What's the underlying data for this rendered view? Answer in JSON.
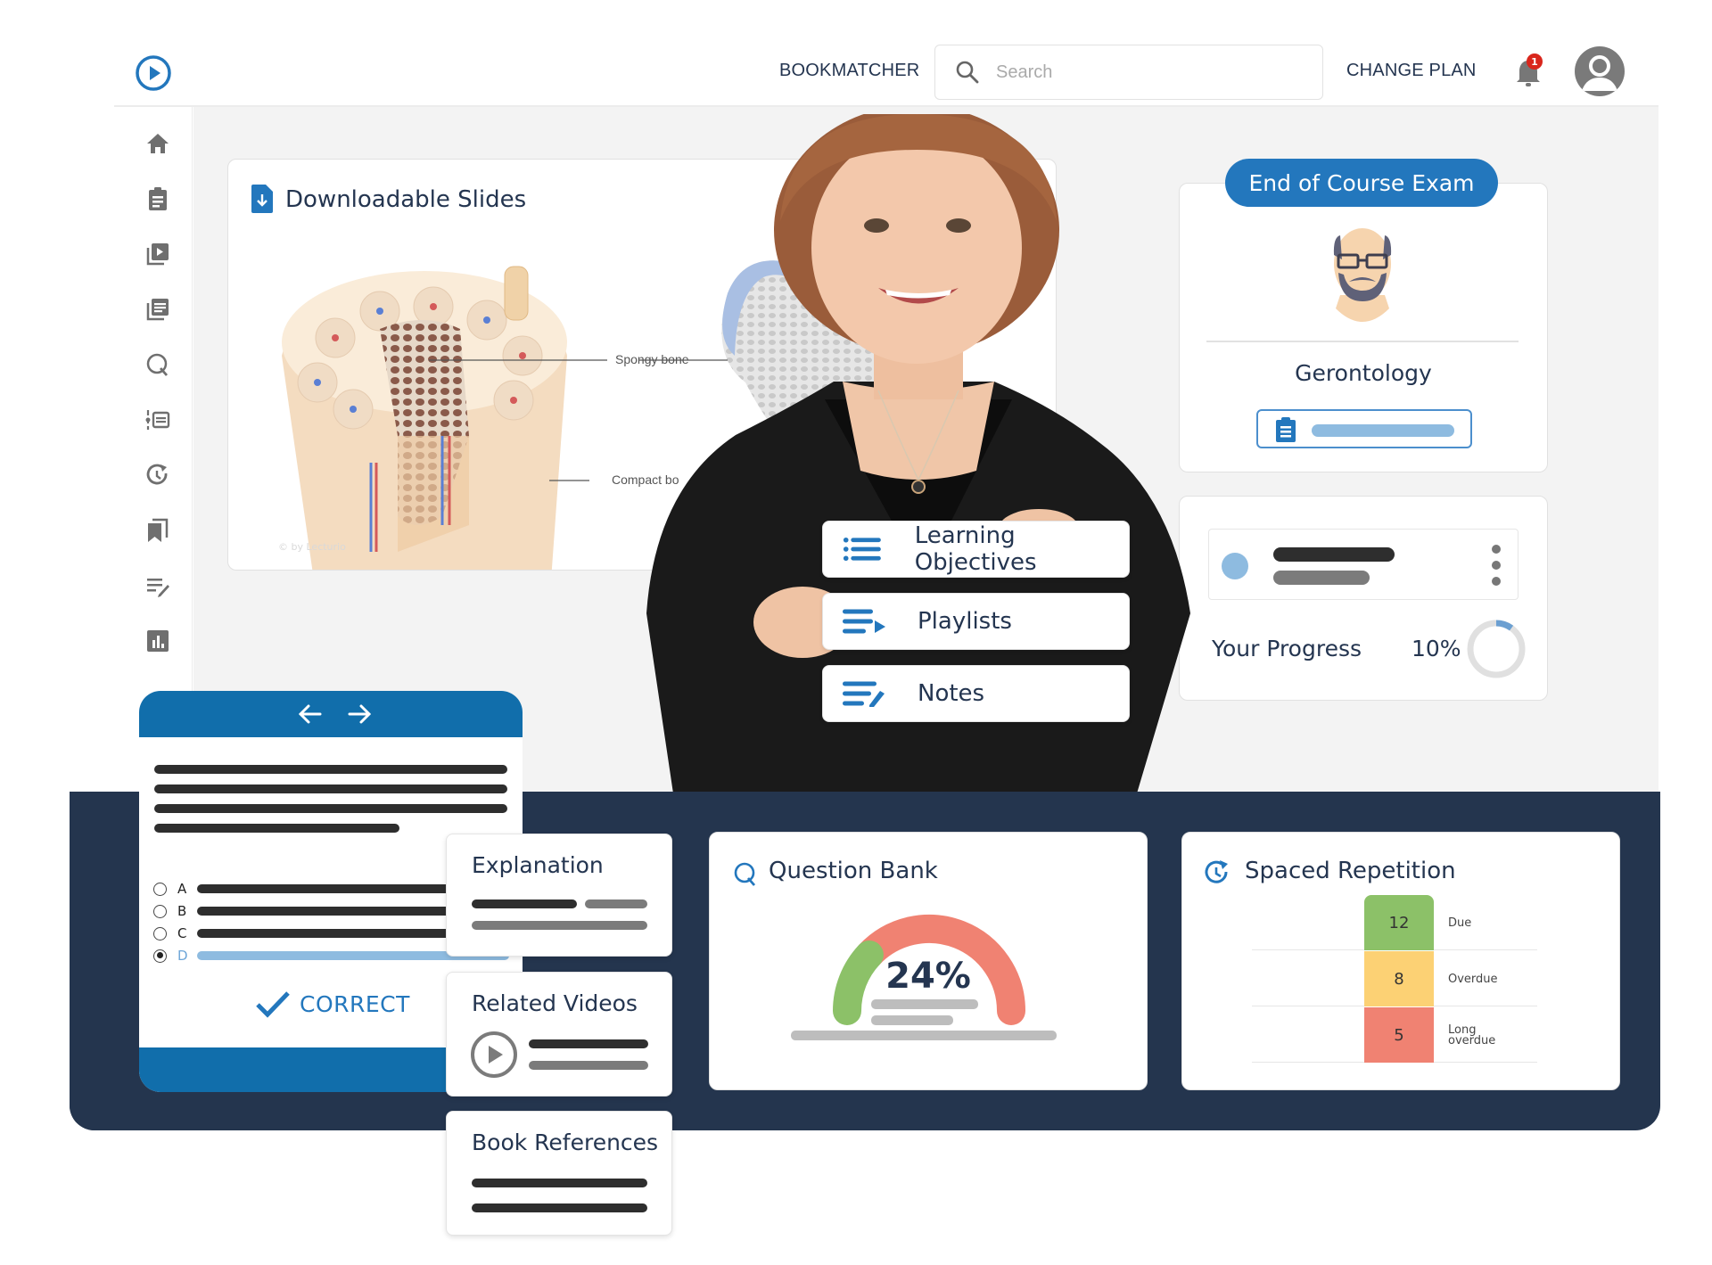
{
  "header": {
    "logo": "play-circle-logo",
    "nav": [
      {
        "label": "BOOKMATCHER"
      },
      {
        "label": "CHANGE PLAN"
      }
    ],
    "search": {
      "placeholder": "Search",
      "value": ""
    },
    "notifications": {
      "count": "1"
    },
    "avatar": "user-avatar-icon"
  },
  "sidebar": {
    "items": [
      {
        "icon": "home-icon"
      },
      {
        "icon": "clipboard-icon"
      },
      {
        "icon": "video-library-icon"
      },
      {
        "icon": "article-library-icon"
      },
      {
        "icon": "question-bank-icon"
      },
      {
        "icon": "outline-list-icon"
      },
      {
        "icon": "spaced-repetition-icon"
      },
      {
        "icon": "bookmarks-icon"
      },
      {
        "icon": "notes-icon"
      },
      {
        "icon": "statistics-icon"
      }
    ]
  },
  "slides": {
    "title": "Downloadable Slides",
    "labels": [
      "Spongy bone",
      "Compact bo"
    ],
    "watermark": "© by Lecturio"
  },
  "exam": {
    "pill": "End of Course Exam",
    "subject": "Gerontology"
  },
  "progress": {
    "label": "Your Progress",
    "value_text": "10%",
    "value": 0.1,
    "colors": {
      "fill": "#6b9fd1",
      "track": "#e0e0e0"
    }
  },
  "video_menu": [
    {
      "label": "Learning Objectives",
      "icon": "list-icon"
    },
    {
      "label": "Playlists",
      "icon": "playlist-icon"
    },
    {
      "label": "Notes",
      "icon": "notes-edit-icon"
    }
  ],
  "quiz": {
    "options": [
      {
        "letter": "A",
        "selected": false
      },
      {
        "letter": "B",
        "selected": false
      },
      {
        "letter": "C",
        "selected": false
      },
      {
        "letter": "D",
        "selected": true
      }
    ],
    "result": "CORRECT"
  },
  "resources": [
    {
      "title": "Explanation"
    },
    {
      "title": "Related Videos"
    },
    {
      "title": "Book References"
    }
  ],
  "question_bank": {
    "title": "Question Bank",
    "percent_text": "24%",
    "percent": 0.24,
    "colors": {
      "correct": "#8cc168",
      "incorrect": "#f08272"
    }
  },
  "spaced_repetition": {
    "title": "Spaced Repetition",
    "rows": [
      {
        "count": "12",
        "label": "Due",
        "color": "#8cc168"
      },
      {
        "count": "8",
        "label": "Overdue",
        "color": "#fcd174"
      },
      {
        "count": "5",
        "label": "Long overdue",
        "color": "#f08272"
      }
    ]
  },
  "colors": {
    "brand": "#2377bd",
    "navy": "#24354e",
    "quiz_blue": "#116eab"
  }
}
